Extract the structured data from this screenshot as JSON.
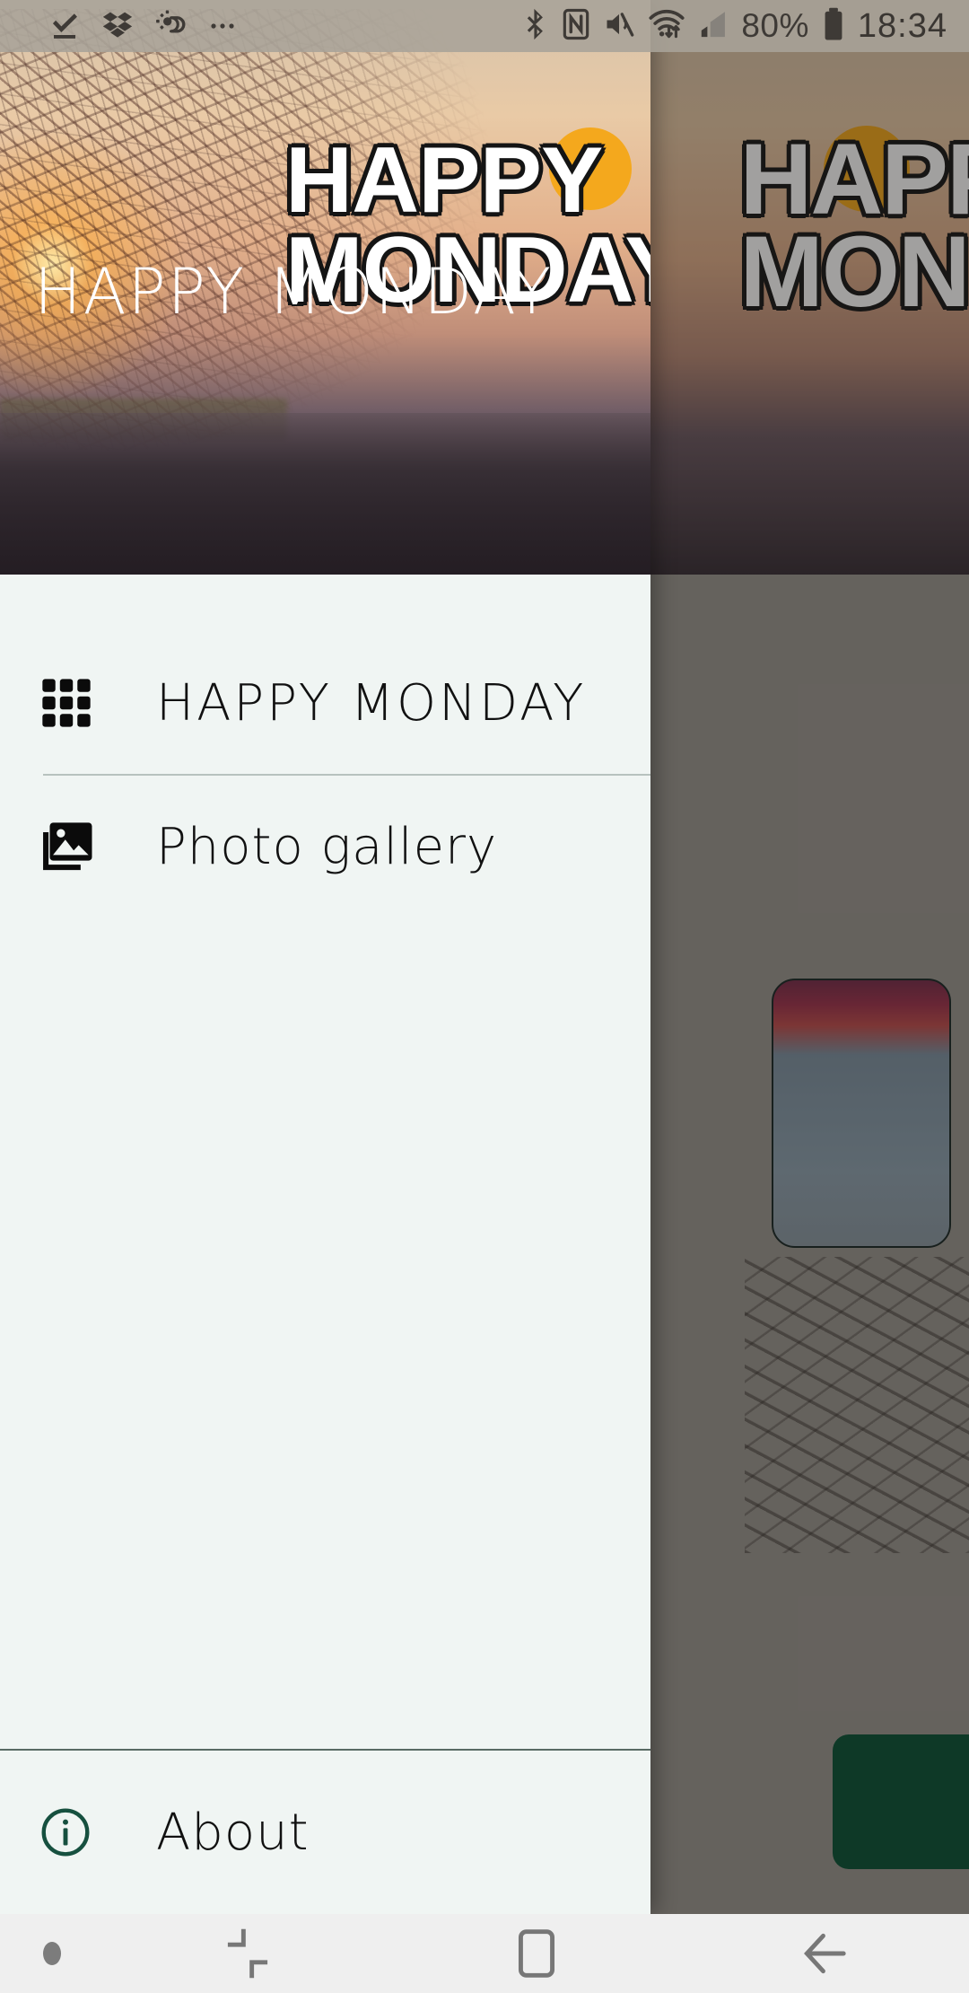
{
  "status_bar": {
    "left_icons": [
      {
        "name": "download-complete-icon",
        "glyph": "check"
      },
      {
        "name": "dropbox-icon",
        "glyph": "dropbox"
      },
      {
        "name": "weather-icon",
        "glyph": "weather"
      },
      {
        "name": "more-notifications-icon",
        "glyph": "ellipsis"
      }
    ],
    "right_icons": [
      {
        "name": "bluetooth-icon",
        "glyph": "bluetooth"
      },
      {
        "name": "nfc-icon",
        "glyph": "nfc"
      },
      {
        "name": "mute-icon",
        "glyph": "mute"
      },
      {
        "name": "wifi-icon",
        "glyph": "wifi"
      },
      {
        "name": "mobile-signal-icon",
        "glyph": "signal"
      }
    ],
    "battery_percent": "80%",
    "time": "18:34"
  },
  "drawer": {
    "header": {
      "overlay_title": "HAPPY MONDAY",
      "banner_line1": "HAPPY",
      "banner_line2": "MONDAY"
    },
    "items": [
      {
        "label": "HAPPY MONDAY",
        "icon": "grid-icon"
      },
      {
        "label": "Photo gallery",
        "icon": "photo-library-icon"
      }
    ],
    "footer": {
      "label": "About",
      "icon": "info-icon"
    }
  },
  "background": {
    "banner_line1": "HAPPY",
    "banner_line2": "MONDAY"
  },
  "nav_bar": {
    "items": [
      {
        "name": "nav-indicator-dot",
        "label": ""
      },
      {
        "name": "nav-recents-button",
        "label": ""
      },
      {
        "name": "nav-home-button",
        "label": ""
      },
      {
        "name": "nav-back-button",
        "label": ""
      }
    ]
  },
  "colors": {
    "drawer_bg": "#f0f5f3",
    "accent_green": "#0a5438",
    "divider": "#b7c2be",
    "status_bar": "#a8a398",
    "nav_bar": "#efefef",
    "sun": "#f4a81d"
  }
}
